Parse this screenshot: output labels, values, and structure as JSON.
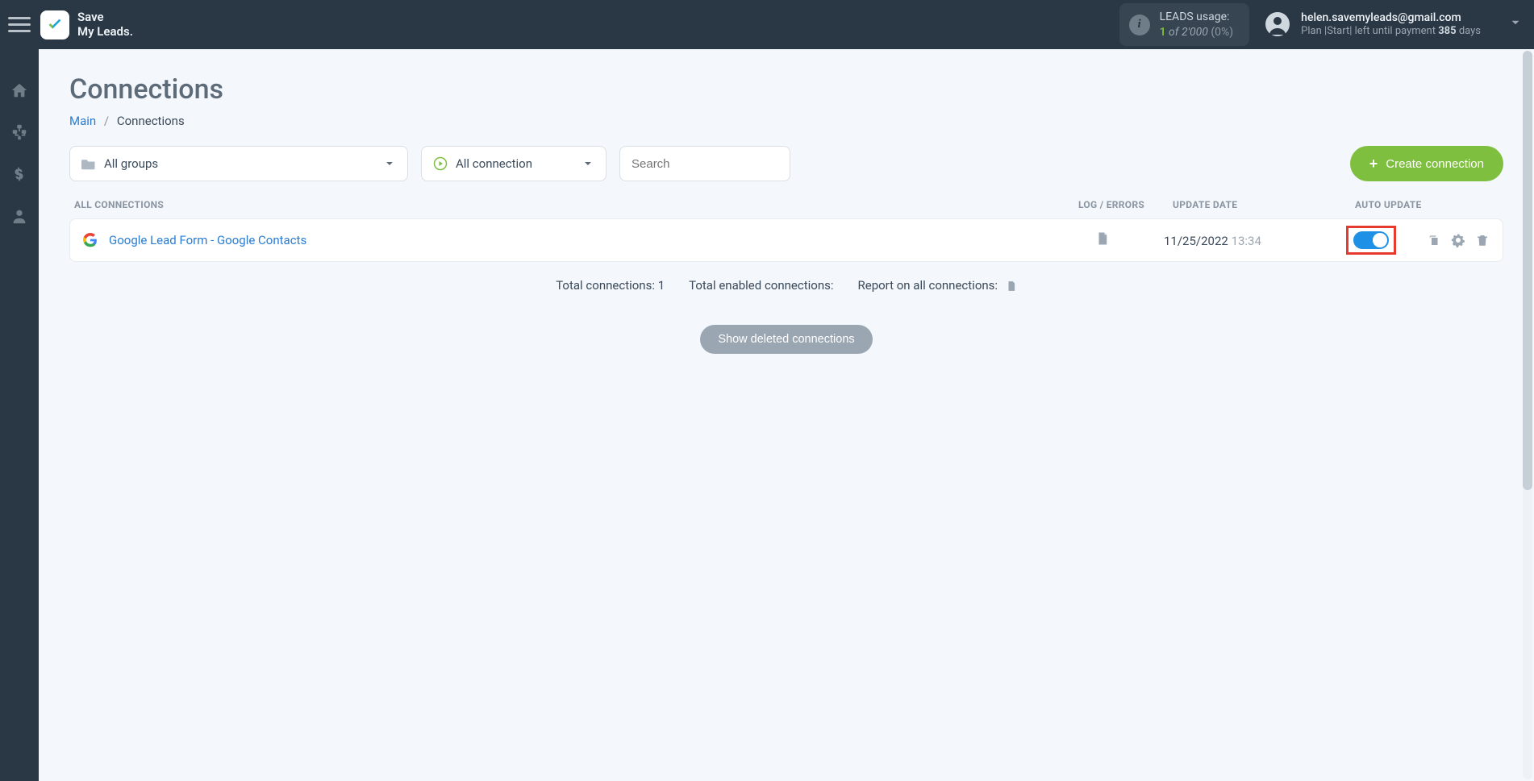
{
  "brand": {
    "line1": "Save",
    "line2": "My Leads"
  },
  "leads": {
    "title": "LEADS usage:",
    "used": "1",
    "of_word": "of",
    "limit": "2'000",
    "pct": "(0%)"
  },
  "user": {
    "email": "helen.savemyleads@gmail.com",
    "plan_prefix": "Plan |",
    "plan_name": "Start",
    "plan_mid": "| left until payment ",
    "days": "385",
    "days_suffix": " days"
  },
  "page": {
    "title": "Connections",
    "breadcrumb_home": "Main",
    "breadcrumb_current": "Connections"
  },
  "filters": {
    "groups_label": "All groups",
    "conn_label": "All connection",
    "search_placeholder": "Search"
  },
  "create_btn": "Create connection",
  "columns": {
    "all": "ALL CONNECTIONS",
    "log": "LOG / ERRORS",
    "date": "UPDATE DATE",
    "auto": "AUTO UPDATE"
  },
  "rows": [
    {
      "name": "Google Lead Form - Google Contacts",
      "date": "11/25/2022",
      "time": "13:34",
      "auto_update": true
    }
  ],
  "summary": {
    "total_label": "Total connections: ",
    "total_value": "1",
    "enabled_label": "Total enabled connections:",
    "report_label": "Report on all connections:"
  },
  "deleted_btn": "Show deleted connections"
}
